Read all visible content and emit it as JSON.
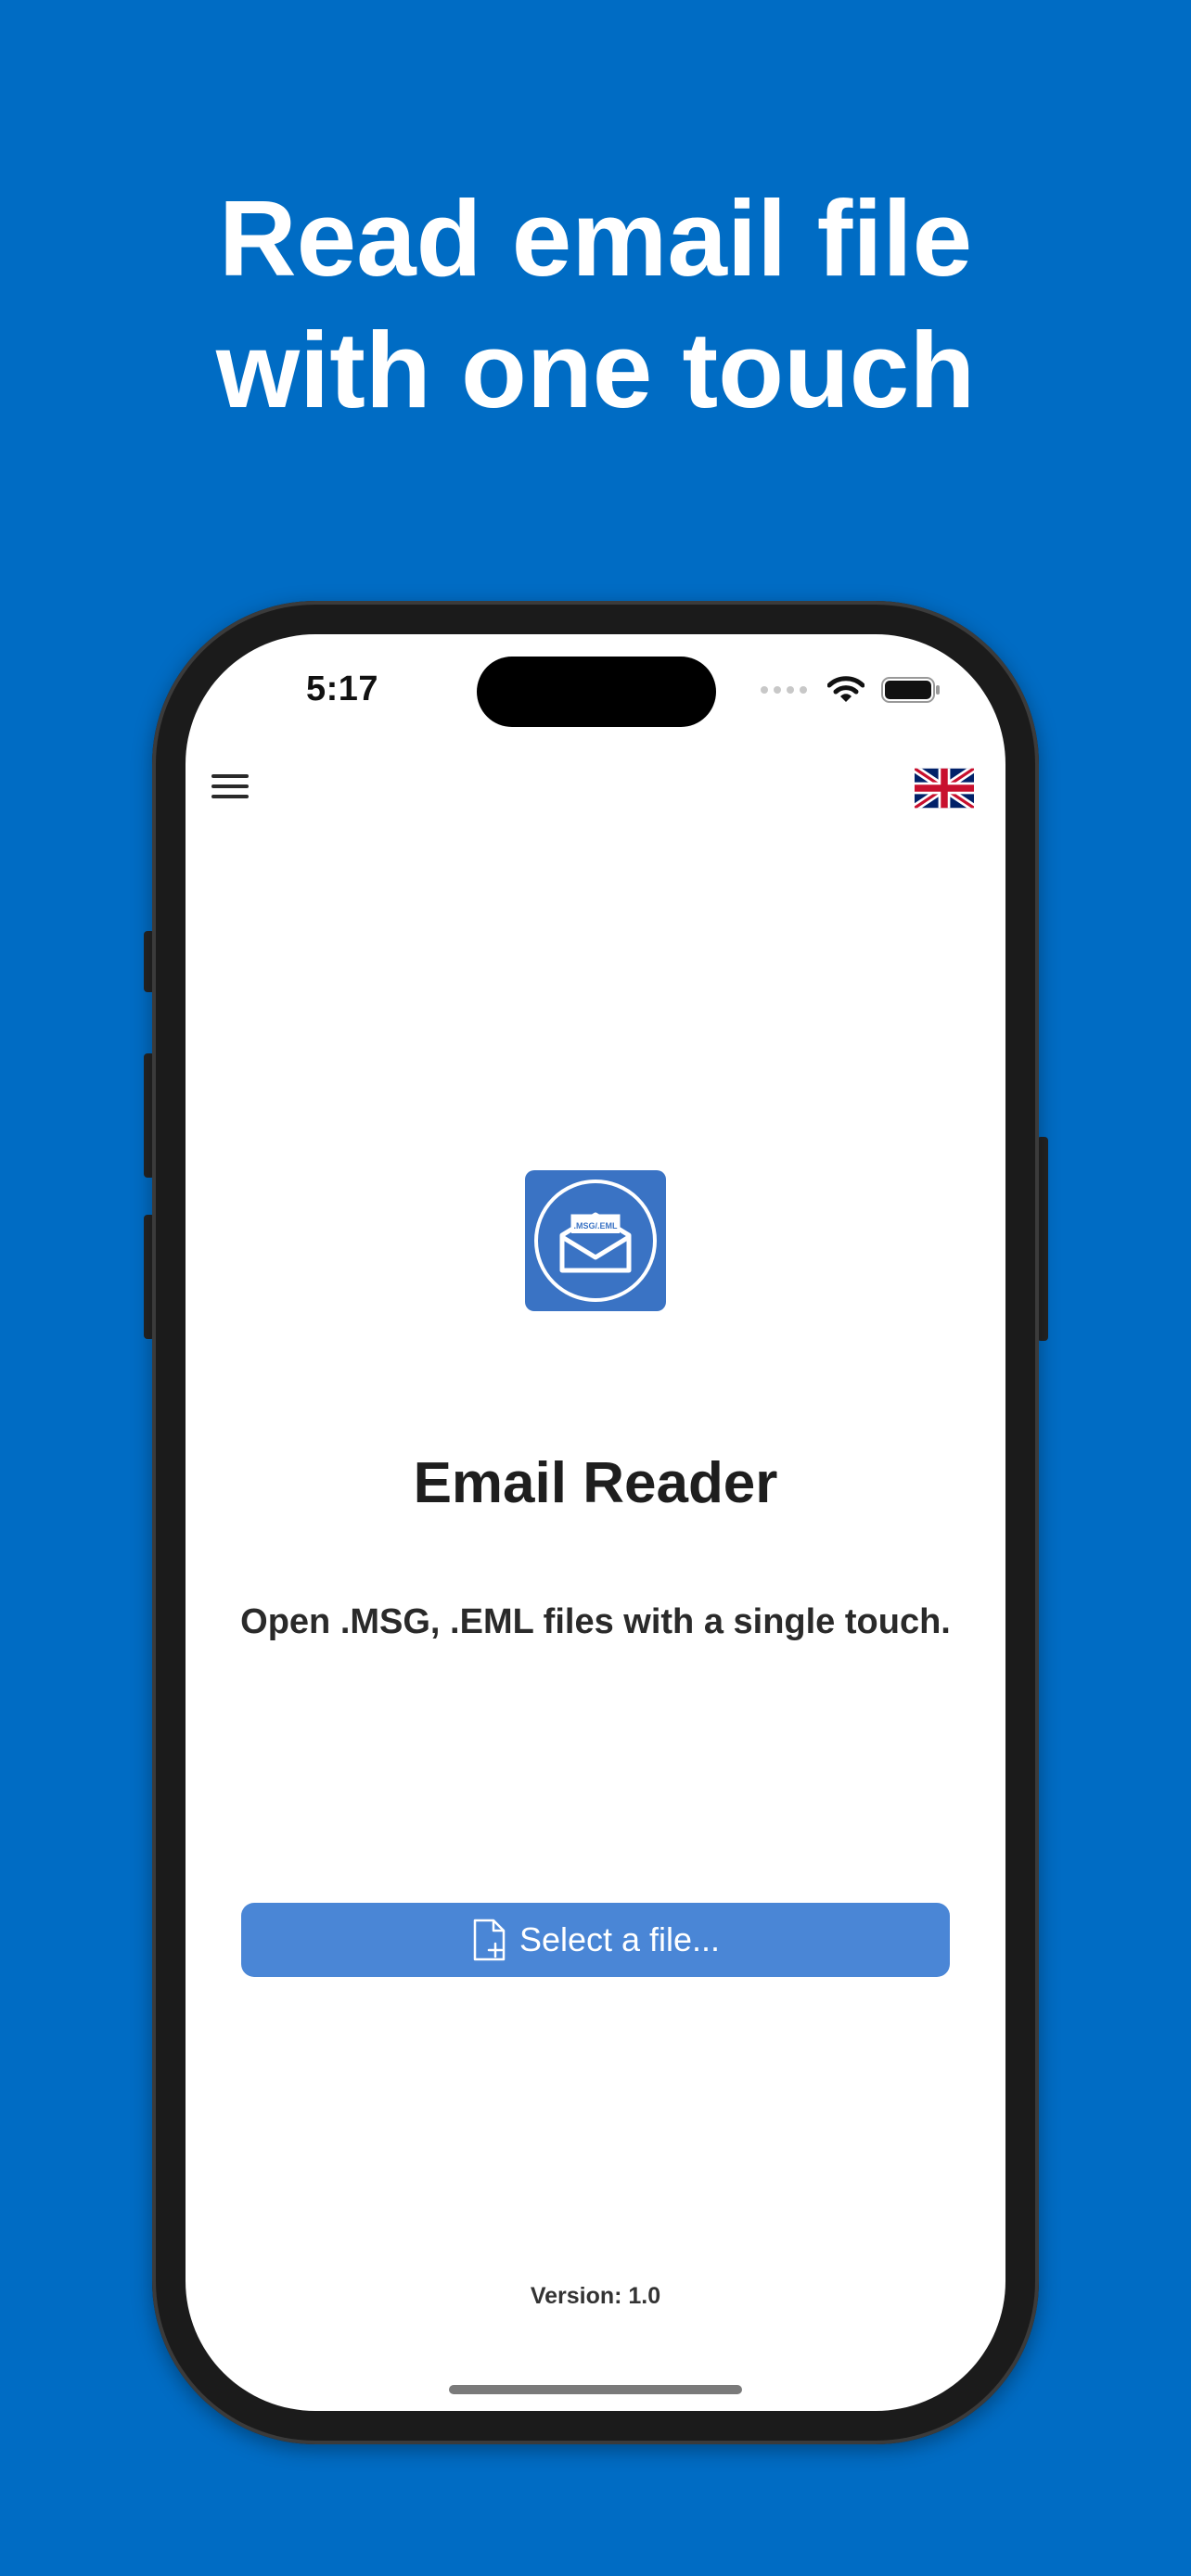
{
  "headline": {
    "line1": "Read email file",
    "line2": "with one touch"
  },
  "status_bar": {
    "time": "5:17"
  },
  "app": {
    "name": "Email Reader",
    "tagline": "Open .MSG, .EML files with a single touch.",
    "icon_text": ".MSG/.EML",
    "select_button_label": "Select a file...",
    "version": "Version: 1.0"
  },
  "icons": {
    "menu": "hamburger-menu-icon",
    "language": "uk-flag-icon",
    "file_add": "file-plus-icon",
    "app": "envelope-icon"
  },
  "colors": {
    "background": "#006cc4",
    "button": "#4a86d6",
    "app_icon": "#3a73c4"
  }
}
